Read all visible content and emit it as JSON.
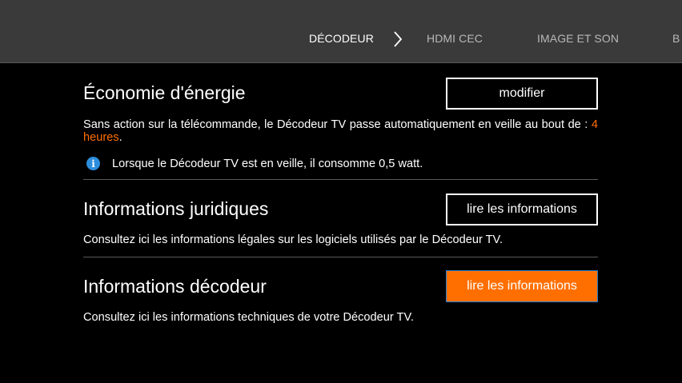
{
  "nav": {
    "tabs": [
      {
        "label": "DÉCODEUR",
        "active": true
      },
      {
        "label": "HDMI CEC",
        "active": false
      },
      {
        "label": "IMAGE ET SON",
        "active": false
      },
      {
        "label": "B",
        "active": false
      }
    ]
  },
  "sections": {
    "energy": {
      "title": "Économie d'énergie",
      "button": "modifier",
      "desc_prefix": "Sans action sur la télécommande, le Décodeur TV passe automatiquement en veille au bout de : ",
      "desc_value": "4 heures",
      "desc_suffix": ".",
      "info_icon": "info-icon",
      "info": "Lorsque le Décodeur TV est en veille, il consomme 0,5 watt."
    },
    "legal": {
      "title": "Informations juridiques",
      "button": "lire les informations",
      "desc": "Consultez ici les informations légales sur les logiciels utilisés par le Décodeur TV."
    },
    "decoder": {
      "title": "Informations décodeur",
      "button": "lire les informations",
      "desc": "Consultez ici les informations techniques de votre Décodeur TV."
    }
  },
  "colors": {
    "accent": "#ff6f00",
    "focus_border": "#1f7fd1",
    "info_icon": "#2d8ddc",
    "topbar": "#3a3a3a"
  }
}
